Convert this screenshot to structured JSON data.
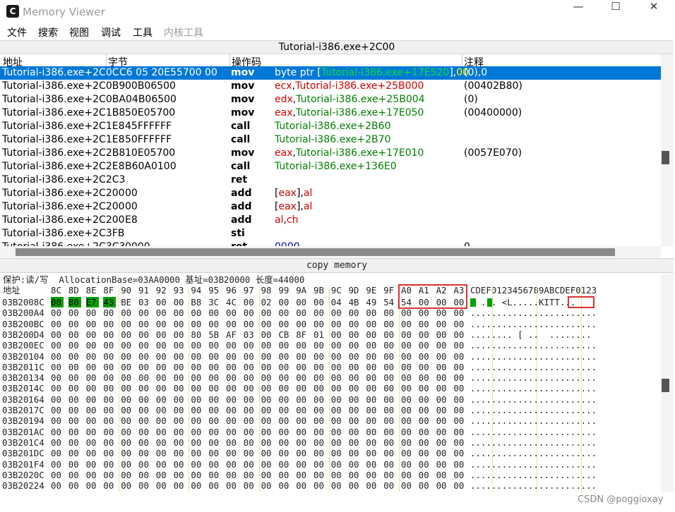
{
  "window": {
    "title": "Memory Viewer",
    "minimize": "—",
    "maximize": "☐",
    "close": "✕"
  },
  "menu": [
    "文件",
    "搜索",
    "视图",
    "调试",
    "工具",
    "内核工具"
  ],
  "address_bar": "Tutorial-i386.exe+2C00",
  "disasm": {
    "headers": {
      "address": "地址",
      "bytes": "字节",
      "opcode": "操作码",
      "comment": "注释"
    },
    "rows": [
      {
        "addr": "Tutorial-i386.exe+2C0C",
        "bytes": "C6 05 20E55700 00",
        "op": "mov",
        "args": [
          {
            "t": "byte ptr [",
            "c": ""
          },
          {
            "t": "Tutorial-i386.exe+17E520",
            "c": "hl-g"
          },
          {
            "t": "],",
            "c": ""
          },
          {
            "t": "00",
            "c": "hl-y"
          }
        ],
        "comment": "(0),0",
        "selected": true
      },
      {
        "addr": "Tutorial-i386.exe+2C0B9",
        "bytes": "00B06500",
        "op": "mov",
        "args": [
          {
            "t": "ecx",
            "c": "reg"
          },
          {
            "t": ",",
            "c": ""
          },
          {
            "t": "Tutorial-i386.exe+25B000",
            "c": "reg"
          }
        ],
        "comment": "(00402B80)"
      },
      {
        "addr": "Tutorial-i386.exe+2C0BA",
        "bytes": "04B06500",
        "op": "mov",
        "args": [
          {
            "t": "edx",
            "c": "reg"
          },
          {
            "t": ",",
            "c": ""
          },
          {
            "t": "Tutorial-i386.exe+25B004",
            "c": "sym"
          }
        ],
        "comment": "(0)"
      },
      {
        "addr": "Tutorial-i386.exe+2C1B8",
        "bytes": "50E05700",
        "op": "mov",
        "args": [
          {
            "t": "eax",
            "c": "reg"
          },
          {
            "t": ",",
            "c": ""
          },
          {
            "t": "Tutorial-i386.exe+17E050",
            "c": "sym"
          }
        ],
        "comment": "(00400000)"
      },
      {
        "addr": "Tutorial-i386.exe+2C1E8",
        "bytes": "45FFFFFF",
        "op": "call",
        "args": [
          {
            "t": "Tutorial-i386.exe+2B60",
            "c": "sym"
          }
        ],
        "comment": ""
      },
      {
        "addr": "Tutorial-i386.exe+2C1E8",
        "bytes": "50FFFFFF",
        "op": "call",
        "args": [
          {
            "t": "Tutorial-i386.exe+2B70",
            "c": "sym"
          }
        ],
        "comment": ""
      },
      {
        "addr": "Tutorial-i386.exe+2C2B8",
        "bytes": "10E05700",
        "op": "mov",
        "args": [
          {
            "t": "eax",
            "c": "reg"
          },
          {
            "t": ",",
            "c": ""
          },
          {
            "t": "Tutorial-i386.exe+17E010",
            "c": "sym"
          }
        ],
        "comment": "(0057E070)"
      },
      {
        "addr": "Tutorial-i386.exe+2C2E8",
        "bytes": "B60A0100",
        "op": "call",
        "args": [
          {
            "t": "Tutorial-i386.exe+136E0",
            "c": "sym"
          }
        ],
        "comment": ""
      },
      {
        "addr": "Tutorial-i386.exe+2C2C3",
        "bytes": "",
        "op": "ret",
        "args": [],
        "comment": ""
      },
      {
        "addr": "Tutorial-i386.exe+2C200",
        "bytes": "00",
        "op": "add",
        "args": [
          {
            "t": "[",
            "c": ""
          },
          {
            "t": "eax",
            "c": "reg"
          },
          {
            "t": "],",
            "c": ""
          },
          {
            "t": "al",
            "c": "reg"
          }
        ],
        "comment": ""
      },
      {
        "addr": "Tutorial-i386.exe+2C200",
        "bytes": "00",
        "op": "add",
        "args": [
          {
            "t": "[",
            "c": ""
          },
          {
            "t": "eax",
            "c": "reg"
          },
          {
            "t": "],",
            "c": ""
          },
          {
            "t": "al",
            "c": "reg"
          }
        ],
        "comment": ""
      },
      {
        "addr": "Tutorial-i386.exe+2C200",
        "bytes": "E8",
        "op": "add",
        "args": [
          {
            "t": "al",
            "c": "reg"
          },
          {
            "t": ",",
            "c": ""
          },
          {
            "t": "ch",
            "c": "reg"
          }
        ],
        "comment": ""
      },
      {
        "addr": "Tutorial-i386.exe+2C3FB",
        "bytes": "",
        "op": "sti",
        "args": [],
        "comment": ""
      },
      {
        "addr": "Tutorial-i386.exe+2C3C3",
        "bytes": "0000",
        "op": "ret",
        "args": [
          {
            "t": "0000",
            "c": "num"
          }
        ],
        "comment": "0"
      }
    ]
  },
  "copy_bar": "copy memory",
  "hex": {
    "info_line": "保护:读/写  AllocationBase=03AA0000 基址=03B20000 长度=44000",
    "header_label": "地址",
    "columns": [
      "8C",
      "8D",
      "8E",
      "8F",
      "90",
      "91",
      "92",
      "93",
      "94",
      "95",
      "96",
      "97",
      "98",
      "99",
      "9A",
      "9B",
      "9C",
      "9D",
      "9E",
      "9F",
      "A0",
      "A1",
      "A2",
      "A3"
    ],
    "ascii_header": "CDEF0123456789ABCDEF0123",
    "rows": [
      {
        "addr": "03B2008C",
        "bytes": [
          "00",
          "80",
          "E7",
          "43",
          "BE",
          "03",
          "00",
          "00",
          "B8",
          "3C",
          "4C",
          "00",
          "02",
          "00",
          "00",
          "00",
          "04",
          "4B",
          "49",
          "54",
          "54",
          "00",
          "00",
          "00"
        ],
        "ascii": "  ... <L.....KITT...",
        "green": [
          0,
          1,
          2,
          3
        ]
      },
      {
        "addr": "03B200A4",
        "bytes": [
          "00",
          "00",
          "00",
          "00",
          "00",
          "00",
          "00",
          "00",
          "00",
          "00",
          "00",
          "00",
          "00",
          "00",
          "00",
          "00",
          "00",
          "00",
          "00",
          "00",
          "00",
          "00",
          "00",
          "00"
        ],
        "ascii": "........................"
      },
      {
        "addr": "03B200BC",
        "bytes": [
          "00",
          "00",
          "00",
          "00",
          "00",
          "00",
          "00",
          "00",
          "00",
          "00",
          "00",
          "00",
          "00",
          "00",
          "00",
          "00",
          "00",
          "00",
          "00",
          "00",
          "00",
          "00",
          "00",
          "00"
        ],
        "ascii": "........................"
      },
      {
        "addr": "03B200D4",
        "bytes": [
          "00",
          "00",
          "00",
          "00",
          "00",
          "00",
          "00",
          "00",
          "80",
          "5B",
          "AF",
          "03",
          "00",
          "CB",
          "8F",
          "01",
          "00",
          "00",
          "00",
          "00",
          "00",
          "00",
          "00",
          "00"
        ],
        "ascii": "........ [ ..  ........"
      },
      {
        "addr": "03B200EC",
        "bytes": [
          "00",
          "00",
          "00",
          "00",
          "00",
          "00",
          "00",
          "00",
          "00",
          "00",
          "00",
          "00",
          "00",
          "00",
          "00",
          "00",
          "00",
          "00",
          "00",
          "00",
          "00",
          "00",
          "00",
          "00"
        ],
        "ascii": "........................"
      },
      {
        "addr": "03B20104",
        "bytes": [
          "00",
          "00",
          "00",
          "00",
          "00",
          "00",
          "00",
          "00",
          "00",
          "00",
          "00",
          "00",
          "00",
          "00",
          "00",
          "00",
          "00",
          "00",
          "00",
          "00",
          "00",
          "00",
          "00",
          "00"
        ],
        "ascii": "........................"
      },
      {
        "addr": "03B2011C",
        "bytes": [
          "00",
          "00",
          "00",
          "00",
          "00",
          "00",
          "00",
          "00",
          "00",
          "00",
          "00",
          "00",
          "00",
          "00",
          "00",
          "00",
          "00",
          "00",
          "00",
          "00",
          "00",
          "00",
          "00",
          "00"
        ],
        "ascii": "........................"
      },
      {
        "addr": "03B20134",
        "bytes": [
          "00",
          "00",
          "00",
          "00",
          "00",
          "00",
          "00",
          "00",
          "00",
          "00",
          "00",
          "00",
          "00",
          "00",
          "00",
          "00",
          "00",
          "00",
          "00",
          "00",
          "00",
          "00",
          "00",
          "00"
        ],
        "ascii": "........................"
      },
      {
        "addr": "03B2014C",
        "bytes": [
          "00",
          "00",
          "00",
          "00",
          "00",
          "00",
          "00",
          "00",
          "00",
          "00",
          "00",
          "00",
          "00",
          "00",
          "00",
          "00",
          "00",
          "00",
          "00",
          "00",
          "00",
          "00",
          "00",
          "00"
        ],
        "ascii": "........................"
      },
      {
        "addr": "03B20164",
        "bytes": [
          "00",
          "00",
          "00",
          "00",
          "00",
          "00",
          "00",
          "00",
          "00",
          "00",
          "00",
          "00",
          "00",
          "00",
          "00",
          "00",
          "00",
          "00",
          "00",
          "00",
          "00",
          "00",
          "00",
          "00"
        ],
        "ascii": "........................"
      },
      {
        "addr": "03B2017C",
        "bytes": [
          "00",
          "00",
          "00",
          "00",
          "00",
          "00",
          "00",
          "00",
          "00",
          "00",
          "00",
          "00",
          "00",
          "00",
          "00",
          "00",
          "00",
          "00",
          "00",
          "00",
          "00",
          "00",
          "00",
          "00"
        ],
        "ascii": "........................"
      },
      {
        "addr": "03B20194",
        "bytes": [
          "00",
          "00",
          "00",
          "00",
          "00",
          "00",
          "00",
          "00",
          "00",
          "00",
          "00",
          "00",
          "00",
          "00",
          "00",
          "00",
          "00",
          "00",
          "00",
          "00",
          "00",
          "00",
          "00",
          "00"
        ],
        "ascii": "........................"
      },
      {
        "addr": "03B201AC",
        "bytes": [
          "00",
          "00",
          "00",
          "00",
          "00",
          "00",
          "00",
          "00",
          "00",
          "00",
          "00",
          "00",
          "00",
          "00",
          "00",
          "00",
          "00",
          "00",
          "00",
          "00",
          "00",
          "00",
          "00",
          "00"
        ],
        "ascii": "........................"
      },
      {
        "addr": "03B201C4",
        "bytes": [
          "00",
          "00",
          "00",
          "00",
          "00",
          "00",
          "00",
          "00",
          "00",
          "00",
          "00",
          "00",
          "00",
          "00",
          "00",
          "00",
          "00",
          "00",
          "00",
          "00",
          "00",
          "00",
          "00",
          "00"
        ],
        "ascii": "........................"
      },
      {
        "addr": "03B201DC",
        "bytes": [
          "00",
          "00",
          "00",
          "00",
          "00",
          "00",
          "00",
          "00",
          "00",
          "00",
          "00",
          "00",
          "00",
          "00",
          "00",
          "00",
          "00",
          "00",
          "00",
          "00",
          "00",
          "00",
          "00",
          "00"
        ],
        "ascii": "........................"
      },
      {
        "addr": "03B201F4",
        "bytes": [
          "00",
          "00",
          "00",
          "00",
          "00",
          "00",
          "00",
          "00",
          "00",
          "00",
          "00",
          "00",
          "00",
          "00",
          "00",
          "00",
          "00",
          "00",
          "00",
          "00",
          "00",
          "00",
          "00",
          "00"
        ],
        "ascii": "........................"
      },
      {
        "addr": "03B2020C",
        "bytes": [
          "00",
          "00",
          "00",
          "00",
          "00",
          "00",
          "00",
          "00",
          "00",
          "00",
          "00",
          "00",
          "00",
          "00",
          "00",
          "00",
          "00",
          "00",
          "00",
          "00",
          "00",
          "00",
          "00",
          "00"
        ],
        "ascii": "........................"
      },
      {
        "addr": "03B20224",
        "bytes": [
          "00",
          "00",
          "00",
          "00",
          "00",
          "00",
          "00",
          "00",
          "00",
          "00",
          "00",
          "00",
          "00",
          "00",
          "00",
          "00",
          "00",
          "00",
          "00",
          "00",
          "00",
          "00",
          "00",
          "00"
        ],
        "ascii": "........................"
      }
    ]
  },
  "watermark": "CSDN @poggioxay"
}
